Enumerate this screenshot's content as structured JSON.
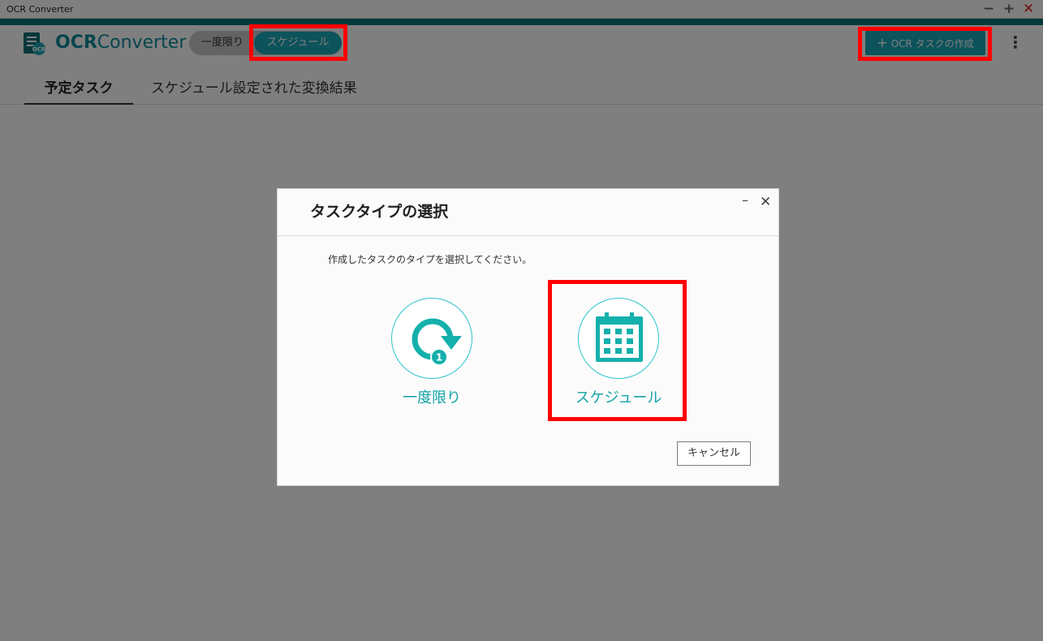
{
  "window": {
    "title": "OCR Converter",
    "minimize_icon": "minus-icon",
    "maximize_icon": "plus-icon",
    "close_icon": "x-icon",
    "accent_color": "#0b7373"
  },
  "header": {
    "logo_bold": "OCR",
    "logo_light": "Converter",
    "mode_once": "一度限り",
    "mode_schedule": "スケジュール",
    "create_task_plus": "+",
    "create_task_label": "OCR タスクの作成",
    "more_icon": "vertical-dots-icon",
    "brand_color": "#1aa7b6"
  },
  "tabs": [
    {
      "label": "予定タスク",
      "active": true
    },
    {
      "label": "スケジュール設定された変換結果",
      "active": false
    }
  ],
  "dialog": {
    "title": "タスクタイプの選択",
    "minimize": "–",
    "close": "✕",
    "prompt": "作成したタスクのタイプを選択してください。",
    "options": [
      {
        "label": "一度限り",
        "icon": "circular-arrow-once-icon",
        "badge": "1"
      },
      {
        "label": "スケジュール",
        "icon": "calendar-icon"
      }
    ],
    "cancel_label": "キャンセル"
  },
  "highlight_color": "#ff0000"
}
